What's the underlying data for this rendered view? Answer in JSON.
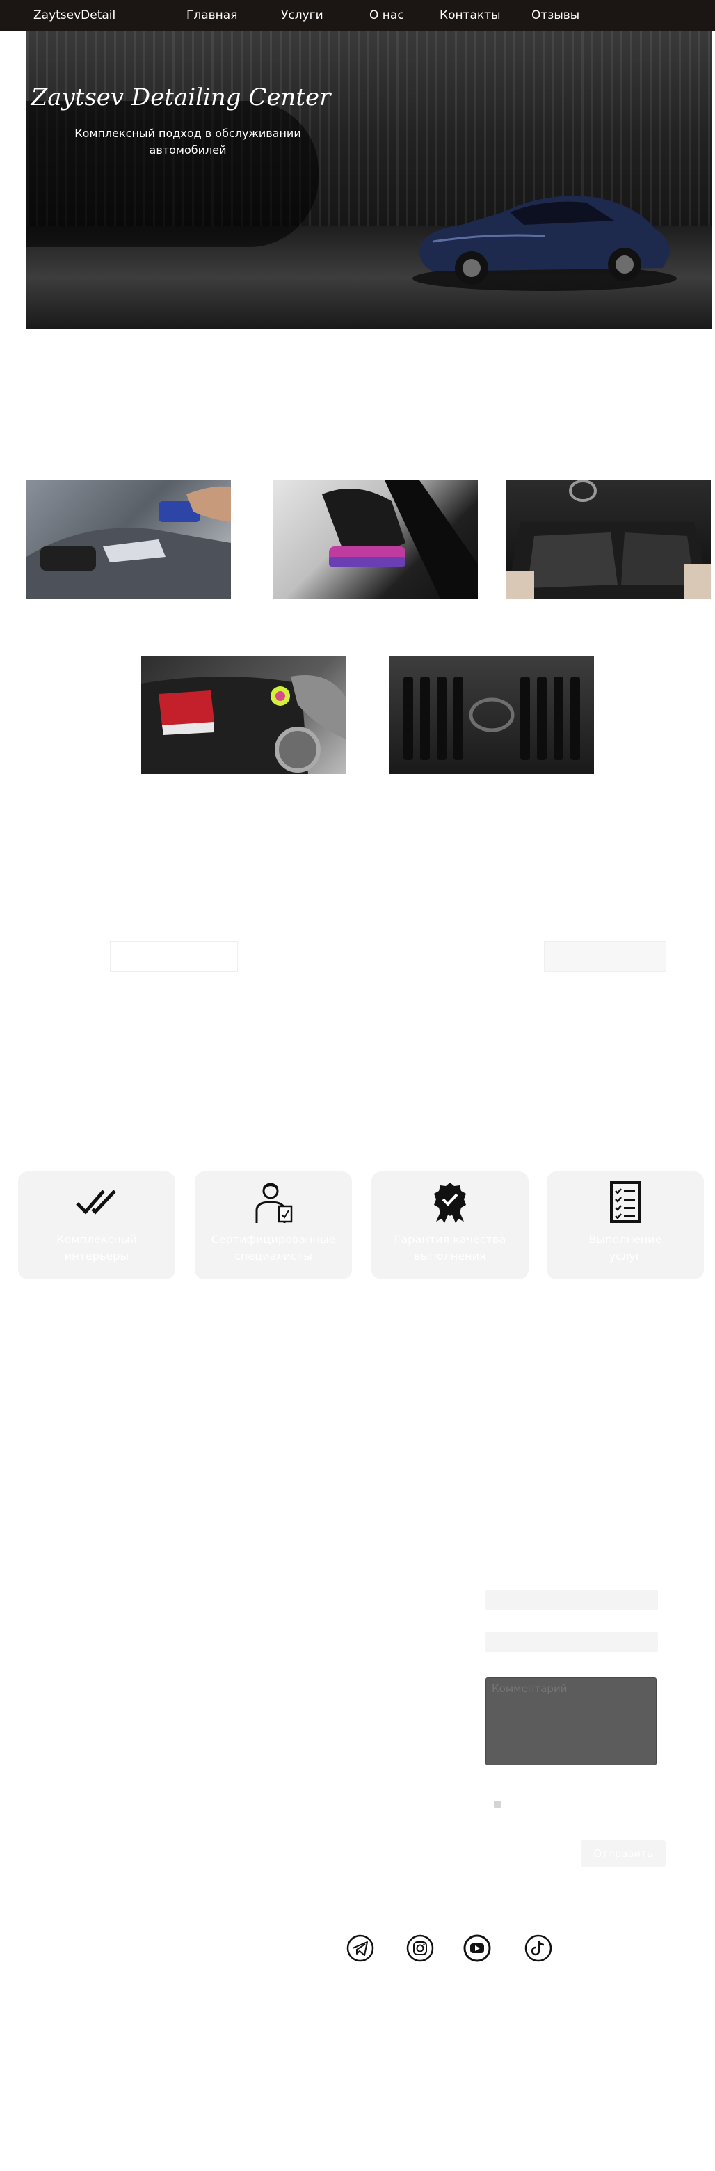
{
  "brand": "ZaytsevDetail",
  "nav": [
    {
      "label": "Главная"
    },
    {
      "label": "Услуги"
    },
    {
      "label": "О нас"
    },
    {
      "label": "Контакты"
    },
    {
      "label": "Отзывы"
    }
  ],
  "hero": {
    "title": "Zaytsev Detailing Center",
    "subtitle_line1": "Комплексный подход в обслуживании",
    "subtitle_line2": "автомобилей"
  },
  "features": [
    {
      "icon": "double-check-icon",
      "line1": "Комплексный",
      "line2": "интерьеры"
    },
    {
      "icon": "specialist-icon",
      "line1": "Сертифицированные",
      "line2": "специалисты"
    },
    {
      "icon": "award-badge-icon",
      "line1": "Гарантия качества",
      "line2": "выполнения"
    },
    {
      "icon": "checklist-icon",
      "line1": "Выполнение",
      "line2": "услуг"
    }
  ],
  "form": {
    "comment_placeholder": "Комментарий",
    "submit_label": "Отправить"
  },
  "social": [
    {
      "icon": "telegram-icon"
    },
    {
      "icon": "instagram-icon"
    },
    {
      "icon": "youtube-icon"
    },
    {
      "icon": "tiktok-icon"
    }
  ]
}
